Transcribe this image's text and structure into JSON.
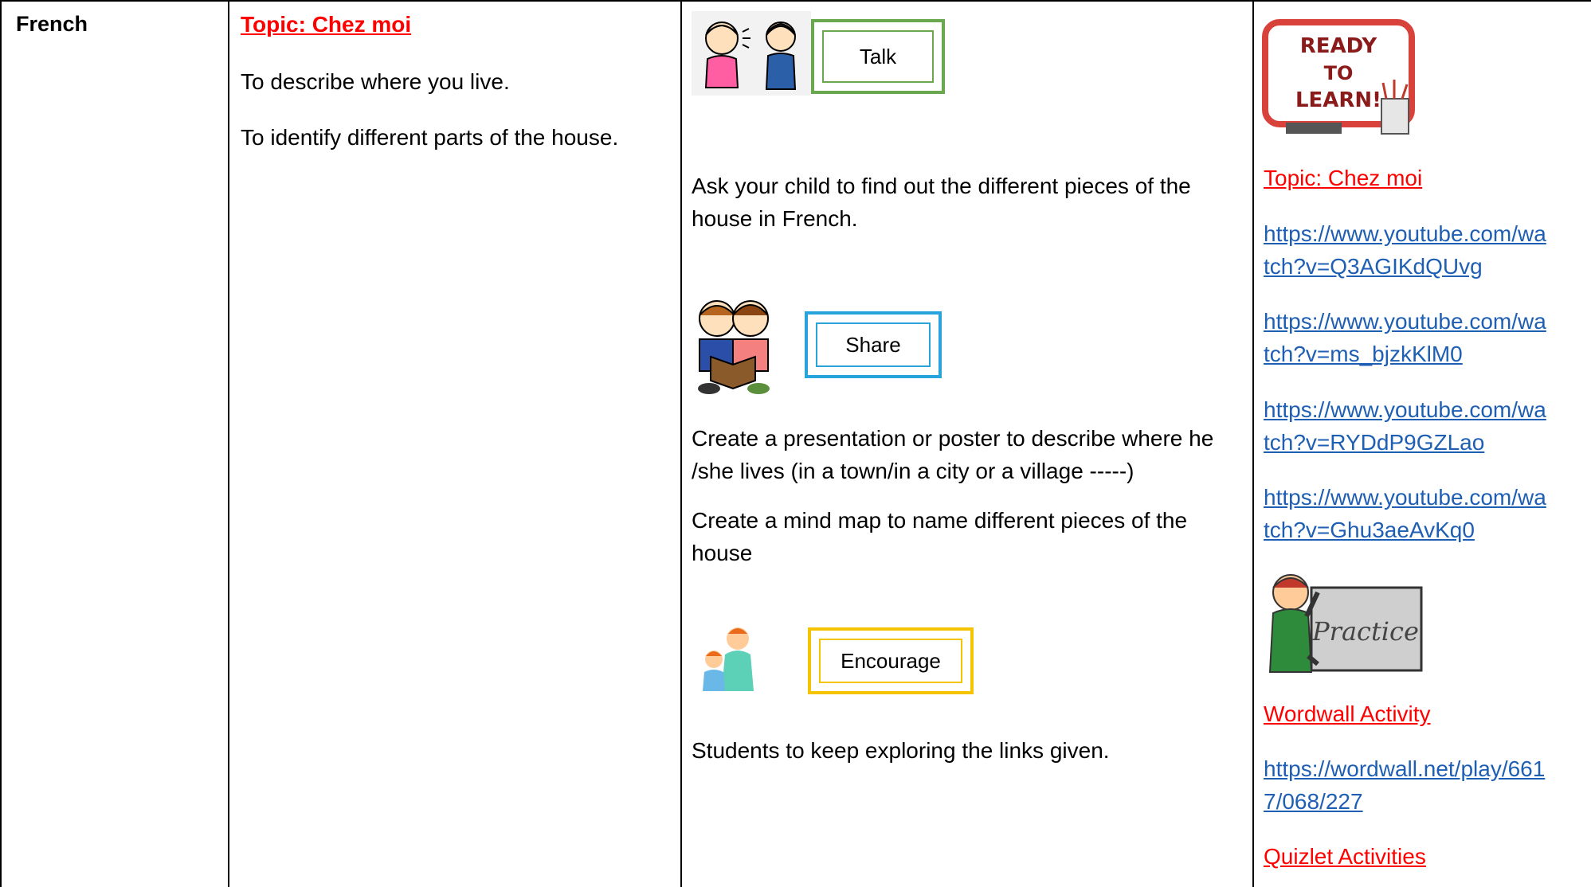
{
  "subject": "French",
  "objectives": {
    "topic": "Topic: Chez moi",
    "lines": [
      "To describe where you live.",
      "To identify different parts of the house."
    ]
  },
  "activities": {
    "talk": {
      "label": "Talk",
      "text": "Ask your child to find out the different pieces of the house in French.",
      "color": "#6aa84f"
    },
    "share": {
      "label": "Share",
      "text1": "Create a presentation or poster to describe where he /she lives (in a town/in a city or a village -----)",
      "text2": "Create a mind map to name different pieces of the house",
      "color": "#29a3dc"
    },
    "encourage": {
      "label": "Encourage",
      "text": "Students to keep exploring the links given.",
      "color": "#f5c400"
    }
  },
  "resources": {
    "ready_sign": [
      "READY",
      "TO",
      "LEARN!"
    ],
    "topic": "Topic: Chez moi",
    "links": [
      [
        "https://www.youtube.com/wa",
        "tch?v=Q3AGIKdQUvg"
      ],
      [
        "https://www.youtube.com/wa",
        "tch?v=ms_bjzkKlM0"
      ],
      [
        "https://www.youtube.com/wa",
        "tch?v=RYDdP9GZLao"
      ],
      [
        "https://www.youtube.com/wa",
        "tch?v=Ghu3aeAvKq0"
      ]
    ],
    "practice_sign": "Practice",
    "wordwall_heading": "Wordwall Activity",
    "wordwall_link": [
      "https://wordwall.net/play/661",
      "7/068/227"
    ],
    "quizlet_heading": "Quizlet Activities"
  }
}
